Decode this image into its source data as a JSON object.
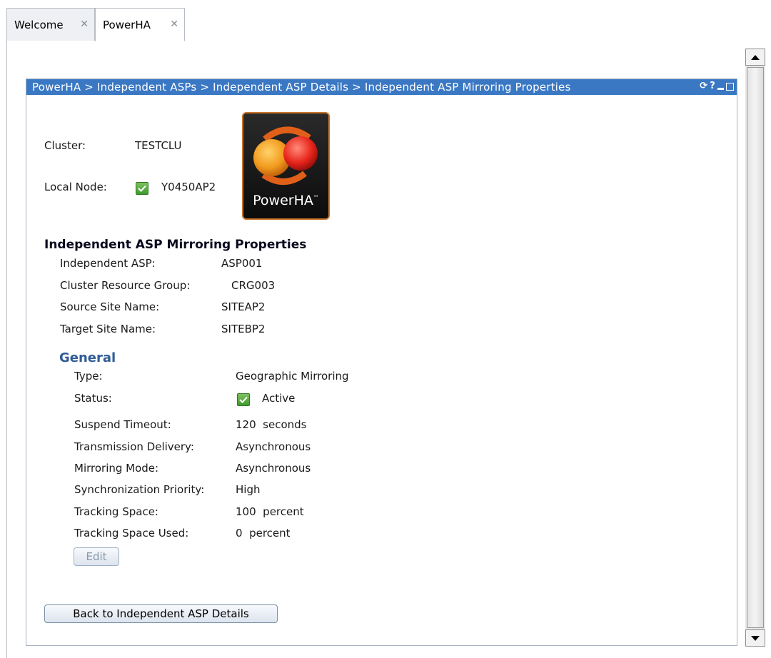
{
  "tabs": [
    {
      "label": "Welcome",
      "close": "✕"
    },
    {
      "label": "PowerHA",
      "close": "✕"
    }
  ],
  "portlet": {
    "breadcrumb": "PowerHA > Independent ASPs > Independent ASP Details > Independent ASP Mirroring Properties"
  },
  "cluster": {
    "label": "Cluster:",
    "value": "TESTCLU"
  },
  "local_node": {
    "label": "Local Node:",
    "value": "Y0450AP2"
  },
  "logo": {
    "text": "PowerHA",
    "tm": "™"
  },
  "section_title": "Independent ASP Mirroring Properties",
  "properties": [
    {
      "label": "Independent ASP:",
      "value": "ASP001"
    },
    {
      "label": "Cluster Resource Group:",
      "value": "CRG003"
    },
    {
      "label": "Source Site Name:",
      "value": "SITEAP2"
    },
    {
      "label": "Target Site Name:",
      "value": "SITEBP2"
    }
  ],
  "general": {
    "title": "General",
    "type": {
      "label": "Type:",
      "value": "Geographic Mirroring"
    },
    "status": {
      "label": "Status:",
      "value": "Active"
    },
    "suspend_timeout": {
      "label": "Suspend Timeout:",
      "value": "120  seconds"
    },
    "transmission_delivery": {
      "label": "Transmission Delivery:",
      "value": "Asynchronous"
    },
    "mirroring_mode": {
      "label": "Mirroring Mode:",
      "value": "Asynchronous"
    },
    "sync_priority": {
      "label": "Synchronization Priority:",
      "value": "High"
    },
    "tracking_space": {
      "label": "Tracking Space:",
      "value": "100  percent"
    },
    "tracking_space_used": {
      "label": "Tracking Space Used:",
      "value": "0  percent"
    }
  },
  "buttons": {
    "edit": "Edit",
    "back": "Back to Independent ASP Details"
  },
  "colors": {
    "title_bar": "#3a78c4",
    "section_heading": "#2f5c96",
    "check_green": "#3f9a2f"
  }
}
